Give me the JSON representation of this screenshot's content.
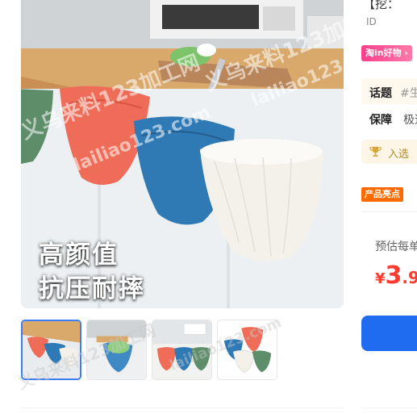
{
  "gallery": {
    "caption_line1": "高颜值",
    "caption_line2": "抗压耐摔",
    "thumbnails": [
      "thumb-1",
      "thumb-2",
      "thumb-3",
      "thumb-4"
    ],
    "active_index": 0
  },
  "info": {
    "title_fragment": "【挖：",
    "id_label": "ID",
    "haowu_tag": "淘in好物 ›",
    "topic_label": "话题",
    "topic_value": "#生",
    "guarantee_label": "保障",
    "guarantee_value": "极速",
    "select_text": "入选",
    "highlight_tag": "产品亮点",
    "estimate_label": "预估每单",
    "price_currency": "¥",
    "price_integer": "3",
    "price_decimal": ".9"
  },
  "watermark": {
    "text_cn": "义乌来料123加工网",
    "text_en": "lailiao123.com"
  },
  "colors": {
    "accent_blue": "#1f6cf0",
    "price_red": "#ff3b30",
    "haowu_pink": "#ff3d8c",
    "highlight_orange": "#ff6a00"
  }
}
